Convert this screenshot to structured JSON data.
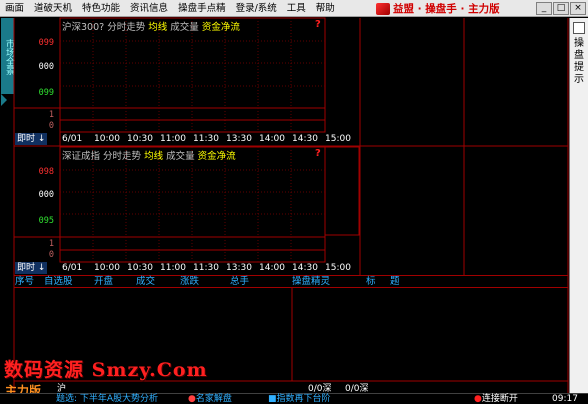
{
  "menu": {
    "items": [
      "画面",
      "道破天机",
      "特色功能",
      "资讯信息",
      "操盘手点精",
      "登录/系统",
      "工具",
      "帮助"
    ]
  },
  "brand": {
    "label": "益盟 · 操盘手 · 主力版"
  },
  "window_buttons": [
    "_",
    "□",
    "×"
  ],
  "side_tab": {
    "label": "市场全景"
  },
  "right_panel": {
    "label": "操盘提示"
  },
  "chart1": {
    "title_prefix": "沪深300? 分时走势",
    "tag1": "均线",
    "tag2": "成交量",
    "tag3": "资金净流",
    "ylabels": [
      "099",
      "000",
      "099"
    ],
    "vol_labels": [
      "1",
      "0"
    ]
  },
  "chart2": {
    "title_prefix": "深证成指 分时走势",
    "tag1": "均线",
    "tag2": "成交量",
    "tag3": "资金净流",
    "ylabels": [
      "098",
      "000",
      "095"
    ],
    "vol_labels": [
      "1",
      "0"
    ]
  },
  "time_axis": {
    "jishi": "即时 ↓",
    "date": "6/01",
    "times": [
      "10:00",
      "10:30",
      "11:00",
      "11:30",
      "13:30",
      "14:00",
      "14:30",
      "15:00"
    ]
  },
  "table": {
    "headers": [
      "序号",
      "自选股",
      "开盘",
      "成交",
      "涨跌",
      "总手",
      "操盘精灵",
      "标",
      "题"
    ]
  },
  "watermark": {
    "main": "数码资源 Smzy.Com",
    "sub": "主力版"
  },
  "index_row": {
    "items": [
      "沪",
      "0/0深",
      "0/0深"
    ]
  },
  "status": {
    "news": "题选: 下半年A股大势分析",
    "expert": "名家解盘",
    "index": "指数再下台阶",
    "conn": "连接断开",
    "time": "09:17"
  }
}
